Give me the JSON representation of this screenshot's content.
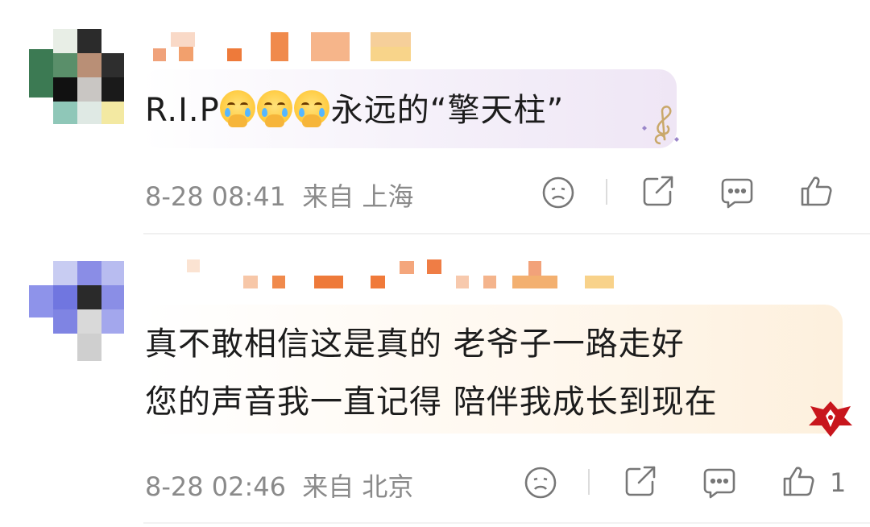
{
  "comments": [
    {
      "text_prefix": "R.I.P",
      "emoji": "crying-face-emoji",
      "emoji_count": 3,
      "text_suffix": "永远的“擎天柱”",
      "date_time": "8-28 08:41",
      "location": "来自 上海",
      "like_count": ""
    },
    {
      "line1": "真不敢相信这是真的 老爷子一路走好",
      "line2": "您的声音我一直记得 陪伴我成长到现在",
      "date_time": "8-28 02:46",
      "location": "来自 北京",
      "like_count": "1"
    }
  ],
  "icons": {
    "dislike": "sad-face-icon",
    "share": "share-icon",
    "reply": "comment-icon",
    "like": "thumbs-up-icon",
    "bubble_deco_1": "music-note-icon",
    "bubble_deco_2": "dragon-badge-icon"
  },
  "colors": {
    "meta_text": "#8a8a8a",
    "icon": "#777777",
    "bubble1": "#f4eff9",
    "bubble2": "#fdf3e6"
  }
}
